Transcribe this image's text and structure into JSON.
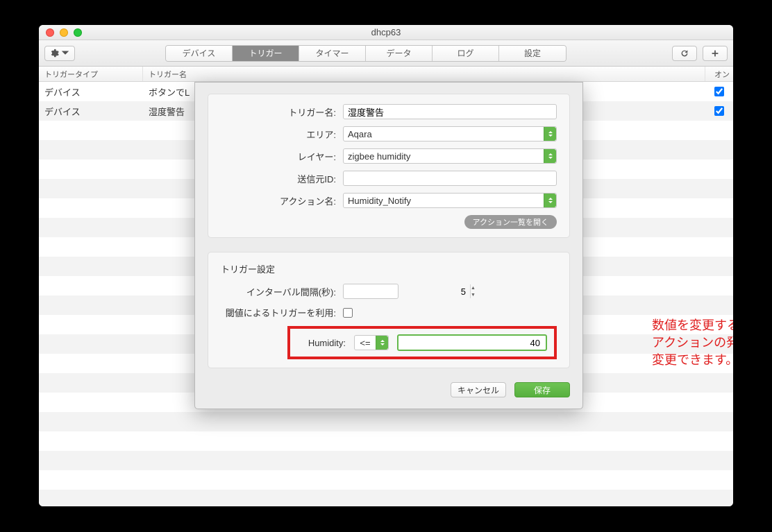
{
  "window_title": "dhcp63",
  "tabs": [
    "デバイス",
    "トリガー",
    "タイマー",
    "データ",
    "ログ",
    "設定"
  ],
  "active_tab_index": 1,
  "columns": {
    "type": "トリガータイプ",
    "name": "トリガー名",
    "on": "オン"
  },
  "rows": [
    {
      "type": "デバイス",
      "name": "ボタンでL",
      "on": true
    },
    {
      "type": "デバイス",
      "name": "湿度警告",
      "on": true
    }
  ],
  "form": {
    "labels": {
      "trigger_name": "トリガー名:",
      "area": "エリア:",
      "layer": "レイヤー:",
      "source_id": "送信元ID:",
      "action_name": "アクション名:"
    },
    "values": {
      "trigger_name": "湿度警告",
      "area": "Aqara",
      "layer": "zigbee humidity",
      "source_id": "",
      "action_name": "Humidity_Notify"
    },
    "open_action_list": "アクション一覧を開く"
  },
  "settings": {
    "title": "トリガー設定",
    "interval_label": "インターバル間隔(秒):",
    "interval_value": "5",
    "threshold_label": "閾値によるトリガーを利用:",
    "threshold_checked": false,
    "humidity_label": "Humidity:",
    "humidity_op": "<=",
    "humidity_value": "40"
  },
  "annotation": "数値を変更することで\nアクションの発行条件が\n変更できます。",
  "buttons": {
    "cancel": "キャンセル",
    "save": "保存"
  }
}
